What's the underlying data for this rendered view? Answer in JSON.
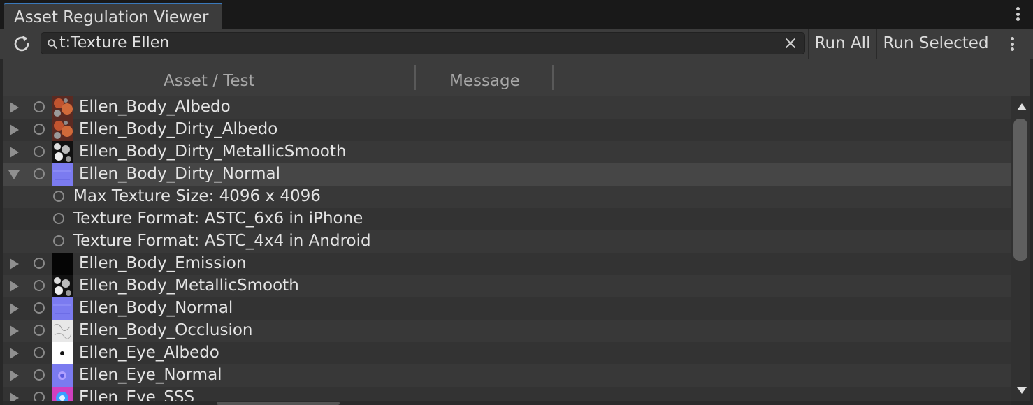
{
  "window": {
    "tab_title": "Asset Regulation Viewer",
    "tab_menu_icon": "kebab-menu-icon"
  },
  "toolbar": {
    "refresh_icon": "refresh-icon",
    "search_icon": "search-icon",
    "search_value": "t:Texture Ellen",
    "clear_icon": "close-icon",
    "run_all_label": "Run All",
    "run_selected_label": "Run Selected",
    "menu_icon": "kebab-menu-icon"
  },
  "table": {
    "columns": [
      "Asset / Test",
      "Message"
    ],
    "rows": [
      {
        "label": "Ellen_Body_Albedo",
        "level": 0,
        "expanded": false,
        "thumbnail": "albedo-texture"
      },
      {
        "label": "Ellen_Body_Dirty_Albedo",
        "level": 0,
        "expanded": false,
        "thumbnail": "albedo-texture"
      },
      {
        "label": "Ellen_Body_Dirty_MetallicSmooth",
        "level": 0,
        "expanded": false,
        "thumbnail": "metallic-texture"
      },
      {
        "label": "Ellen_Body_Dirty_Normal",
        "level": 0,
        "expanded": true,
        "selected": true,
        "thumbnail": "normal-texture"
      },
      {
        "label": "Max Texture Size: 4096 x 4096",
        "level": 1
      },
      {
        "label": "Texture Format: ASTC_6x6 in iPhone",
        "level": 1
      },
      {
        "label": "Texture Format: ASTC_4x4 in Android",
        "level": 1
      },
      {
        "label": "Ellen_Body_Emission",
        "level": 0,
        "expanded": false,
        "thumbnail": "emission-texture"
      },
      {
        "label": "Ellen_Body_MetallicSmooth",
        "level": 0,
        "expanded": false,
        "thumbnail": "metallic-texture"
      },
      {
        "label": "Ellen_Body_Normal",
        "level": 0,
        "expanded": false,
        "thumbnail": "normal-texture"
      },
      {
        "label": "Ellen_Body_Occlusion",
        "level": 0,
        "expanded": false,
        "thumbnail": "occlusion-texture"
      },
      {
        "label": "Ellen_Eye_Albedo",
        "level": 0,
        "expanded": false,
        "thumbnail": "eye-albedo-texture"
      },
      {
        "label": "Ellen_Eye_Normal",
        "level": 0,
        "expanded": false,
        "thumbnail": "eye-normal-texture"
      },
      {
        "label": "Ellen_Eye_SSS",
        "level": 0,
        "expanded": false,
        "thumbnail": "eye-sss-texture"
      }
    ]
  },
  "colors": {
    "accent": "#3a79bb",
    "panel": "#282828",
    "toolbar": "#3c3c3c",
    "row_odd": "#383838",
    "row_even": "#333333",
    "row_selected": "#464646",
    "normal_map": "#7b7bf0"
  }
}
